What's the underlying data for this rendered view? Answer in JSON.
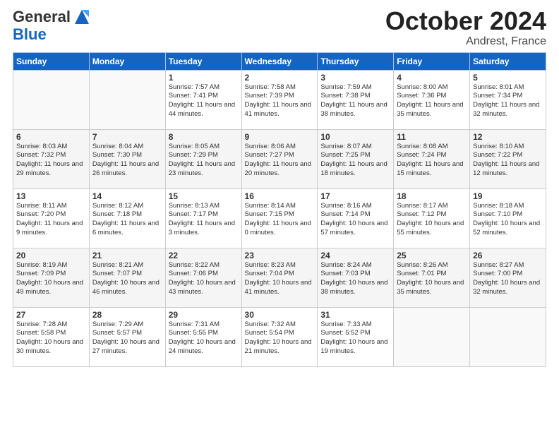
{
  "header": {
    "logo_general": "General",
    "logo_blue": "Blue",
    "month": "October 2024",
    "location": "Andrest, France"
  },
  "days_of_week": [
    "Sunday",
    "Monday",
    "Tuesday",
    "Wednesday",
    "Thursday",
    "Friday",
    "Saturday"
  ],
  "weeks": [
    [
      {
        "day": "",
        "sunrise": "",
        "sunset": "",
        "daylight": ""
      },
      {
        "day": "",
        "sunrise": "",
        "sunset": "",
        "daylight": ""
      },
      {
        "day": "1",
        "sunrise": "Sunrise: 7:57 AM",
        "sunset": "Sunset: 7:41 PM",
        "daylight": "Daylight: 11 hours and 44 minutes."
      },
      {
        "day": "2",
        "sunrise": "Sunrise: 7:58 AM",
        "sunset": "Sunset: 7:39 PM",
        "daylight": "Daylight: 11 hours and 41 minutes."
      },
      {
        "day": "3",
        "sunrise": "Sunrise: 7:59 AM",
        "sunset": "Sunset: 7:38 PM",
        "daylight": "Daylight: 11 hours and 38 minutes."
      },
      {
        "day": "4",
        "sunrise": "Sunrise: 8:00 AM",
        "sunset": "Sunset: 7:36 PM",
        "daylight": "Daylight: 11 hours and 35 minutes."
      },
      {
        "day": "5",
        "sunrise": "Sunrise: 8:01 AM",
        "sunset": "Sunset: 7:34 PM",
        "daylight": "Daylight: 11 hours and 32 minutes."
      }
    ],
    [
      {
        "day": "6",
        "sunrise": "Sunrise: 8:03 AM",
        "sunset": "Sunset: 7:32 PM",
        "daylight": "Daylight: 11 hours and 29 minutes."
      },
      {
        "day": "7",
        "sunrise": "Sunrise: 8:04 AM",
        "sunset": "Sunset: 7:30 PM",
        "daylight": "Daylight: 11 hours and 26 minutes."
      },
      {
        "day": "8",
        "sunrise": "Sunrise: 8:05 AM",
        "sunset": "Sunset: 7:29 PM",
        "daylight": "Daylight: 11 hours and 23 minutes."
      },
      {
        "day": "9",
        "sunrise": "Sunrise: 8:06 AM",
        "sunset": "Sunset: 7:27 PM",
        "daylight": "Daylight: 11 hours and 20 minutes."
      },
      {
        "day": "10",
        "sunrise": "Sunrise: 8:07 AM",
        "sunset": "Sunset: 7:25 PM",
        "daylight": "Daylight: 11 hours and 18 minutes."
      },
      {
        "day": "11",
        "sunrise": "Sunrise: 8:08 AM",
        "sunset": "Sunset: 7:24 PM",
        "daylight": "Daylight: 11 hours and 15 minutes."
      },
      {
        "day": "12",
        "sunrise": "Sunrise: 8:10 AM",
        "sunset": "Sunset: 7:22 PM",
        "daylight": "Daylight: 11 hours and 12 minutes."
      }
    ],
    [
      {
        "day": "13",
        "sunrise": "Sunrise: 8:11 AM",
        "sunset": "Sunset: 7:20 PM",
        "daylight": "Daylight: 11 hours and 9 minutes."
      },
      {
        "day": "14",
        "sunrise": "Sunrise: 8:12 AM",
        "sunset": "Sunset: 7:18 PM",
        "daylight": "Daylight: 11 hours and 6 minutes."
      },
      {
        "day": "15",
        "sunrise": "Sunrise: 8:13 AM",
        "sunset": "Sunset: 7:17 PM",
        "daylight": "Daylight: 11 hours and 3 minutes."
      },
      {
        "day": "16",
        "sunrise": "Sunrise: 8:14 AM",
        "sunset": "Sunset: 7:15 PM",
        "daylight": "Daylight: 11 hours and 0 minutes."
      },
      {
        "day": "17",
        "sunrise": "Sunrise: 8:16 AM",
        "sunset": "Sunset: 7:14 PM",
        "daylight": "Daylight: 10 hours and 57 minutes."
      },
      {
        "day": "18",
        "sunrise": "Sunrise: 8:17 AM",
        "sunset": "Sunset: 7:12 PM",
        "daylight": "Daylight: 10 hours and 55 minutes."
      },
      {
        "day": "19",
        "sunrise": "Sunrise: 8:18 AM",
        "sunset": "Sunset: 7:10 PM",
        "daylight": "Daylight: 10 hours and 52 minutes."
      }
    ],
    [
      {
        "day": "20",
        "sunrise": "Sunrise: 8:19 AM",
        "sunset": "Sunset: 7:09 PM",
        "daylight": "Daylight: 10 hours and 49 minutes."
      },
      {
        "day": "21",
        "sunrise": "Sunrise: 8:21 AM",
        "sunset": "Sunset: 7:07 PM",
        "daylight": "Daylight: 10 hours and 46 minutes."
      },
      {
        "day": "22",
        "sunrise": "Sunrise: 8:22 AM",
        "sunset": "Sunset: 7:06 PM",
        "daylight": "Daylight: 10 hours and 43 minutes."
      },
      {
        "day": "23",
        "sunrise": "Sunrise: 8:23 AM",
        "sunset": "Sunset: 7:04 PM",
        "daylight": "Daylight: 10 hours and 41 minutes."
      },
      {
        "day": "24",
        "sunrise": "Sunrise: 8:24 AM",
        "sunset": "Sunset: 7:03 PM",
        "daylight": "Daylight: 10 hours and 38 minutes."
      },
      {
        "day": "25",
        "sunrise": "Sunrise: 8:26 AM",
        "sunset": "Sunset: 7:01 PM",
        "daylight": "Daylight: 10 hours and 35 minutes."
      },
      {
        "day": "26",
        "sunrise": "Sunrise: 8:27 AM",
        "sunset": "Sunset: 7:00 PM",
        "daylight": "Daylight: 10 hours and 32 minutes."
      }
    ],
    [
      {
        "day": "27",
        "sunrise": "Sunrise: 7:28 AM",
        "sunset": "Sunset: 5:58 PM",
        "daylight": "Daylight: 10 hours and 30 minutes."
      },
      {
        "day": "28",
        "sunrise": "Sunrise: 7:29 AM",
        "sunset": "Sunset: 5:57 PM",
        "daylight": "Daylight: 10 hours and 27 minutes."
      },
      {
        "day": "29",
        "sunrise": "Sunrise: 7:31 AM",
        "sunset": "Sunset: 5:55 PM",
        "daylight": "Daylight: 10 hours and 24 minutes."
      },
      {
        "day": "30",
        "sunrise": "Sunrise: 7:32 AM",
        "sunset": "Sunset: 5:54 PM",
        "daylight": "Daylight: 10 hours and 21 minutes."
      },
      {
        "day": "31",
        "sunrise": "Sunrise: 7:33 AM",
        "sunset": "Sunset: 5:52 PM",
        "daylight": "Daylight: 10 hours and 19 minutes."
      },
      {
        "day": "",
        "sunrise": "",
        "sunset": "",
        "daylight": ""
      },
      {
        "day": "",
        "sunrise": "",
        "sunset": "",
        "daylight": ""
      }
    ]
  ]
}
